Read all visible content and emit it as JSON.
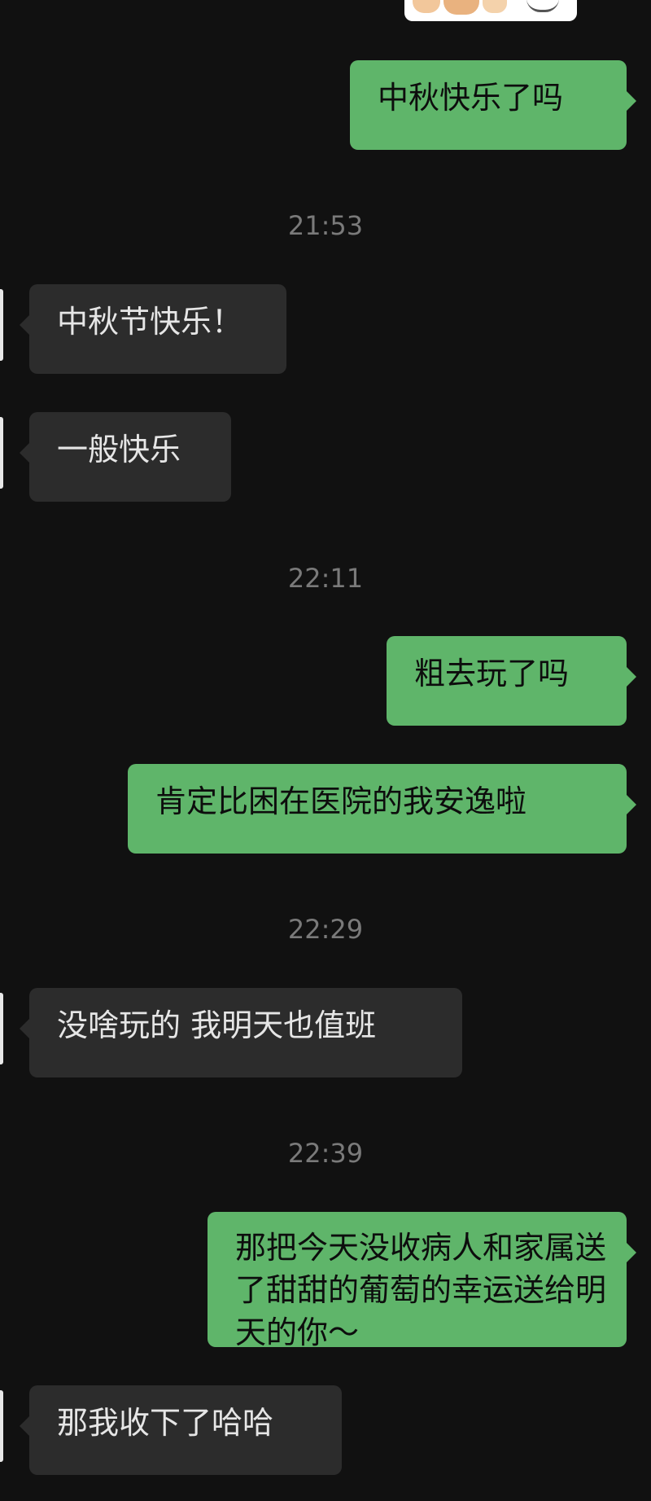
{
  "messages": [
    {
      "from": "me",
      "text": "中秋快乐了吗"
    },
    {
      "time": "21:53"
    },
    {
      "from": "other",
      "text": "中秋节快乐！"
    },
    {
      "from": "other",
      "text": "一般快乐"
    },
    {
      "time": "22:11"
    },
    {
      "from": "me",
      "text": "粗去玩了吗"
    },
    {
      "from": "me",
      "text": "肯定比困在医院的我安逸啦"
    },
    {
      "time": "22:29"
    },
    {
      "from": "other",
      "text": "没啥玩的 我明天也值班"
    },
    {
      "time": "22:39"
    },
    {
      "from": "me",
      "text": "那把今天没收病人和家属送了甜甜的葡萄的幸运送给明天的你～"
    },
    {
      "from": "other",
      "text": "那我收下了哈哈"
    }
  ],
  "colors": {
    "background": "#111111",
    "outgoing_bubble": "#5fb56a",
    "incoming_bubble": "#2c2c2c",
    "timestamp": "#7a7a7a"
  }
}
